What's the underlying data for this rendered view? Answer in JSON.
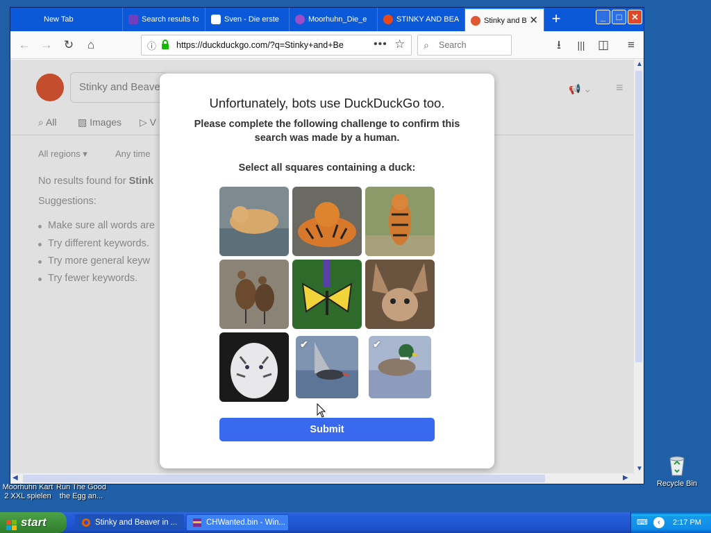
{
  "desktop": {
    "left_labels": [
      {
        "line1": "Moorhuhn Kart",
        "line2": "2 XXL spielen"
      },
      {
        "line1": "Run The Good",
        "line2": "the Egg an..."
      }
    ],
    "recycle_bin_label": "Recycle Bin"
  },
  "browser": {
    "tabs": [
      {
        "label": "New Tab",
        "active": false,
        "icon_color": "#0b58d8"
      },
      {
        "label": "Search results fo",
        "active": false,
        "icon_color": "#6f3fbf"
      },
      {
        "label": "Sven - Die erste",
        "active": false,
        "icon_color": "#ffffff"
      },
      {
        "label": "Moorhuhn_Die_e",
        "active": false,
        "icon_color": "#9b4dca"
      },
      {
        "label": "STINKY AND BEA",
        "active": false,
        "icon_color": "#e64a19"
      },
      {
        "label": "Stinky and B",
        "active": true,
        "icon_color": "#de5833"
      }
    ],
    "url": "https://duckduckgo.com/?q=Stinky+and+Be",
    "search_placeholder": "Search"
  },
  "ddg_page": {
    "search_value": "Stinky and Beave",
    "tabs": [
      "All",
      "Images",
      "V"
    ],
    "filters": [
      "All regions ▾",
      "Any time"
    ],
    "no_results_prefix": "No results found for ",
    "no_results_query": "Stink",
    "suggestions_label": "Suggestions:",
    "suggestions": [
      "Make sure all words are",
      "Try different keywords.",
      "Try more general keyw",
      "Try fewer keywords."
    ]
  },
  "captcha": {
    "title": "Unfortunately, bots use DuckDuckGo too.",
    "subtitle": "Please complete the following challenge to confirm this search was made by a human.",
    "instruction": "Select all squares containing a duck:",
    "tiles": [
      {
        "subject": "lion-cub-in-water",
        "selected": false
      },
      {
        "subject": "lying-tiger",
        "selected": false
      },
      {
        "subject": "walking-tiger",
        "selected": false
      },
      {
        "subject": "whistling-ducks",
        "selected": false
      },
      {
        "subject": "swallowtail-butterfly",
        "selected": false
      },
      {
        "subject": "fennec-fox",
        "selected": false
      },
      {
        "subject": "white-tiger",
        "selected": false
      },
      {
        "subject": "duck-flying-over-water",
        "selected": true
      },
      {
        "subject": "mallard-duck",
        "selected": true
      }
    ],
    "submit_label": "Submit",
    "accent_color": "#3969ef"
  },
  "taskbar": {
    "start_label": "start",
    "tasks": [
      {
        "label": "Stinky and Beaver in ...",
        "icon": "firefox-icon"
      },
      {
        "label": "CHWanted.bin - Win...",
        "icon": "winrar-icon"
      }
    ],
    "clock": "2:17 PM"
  }
}
